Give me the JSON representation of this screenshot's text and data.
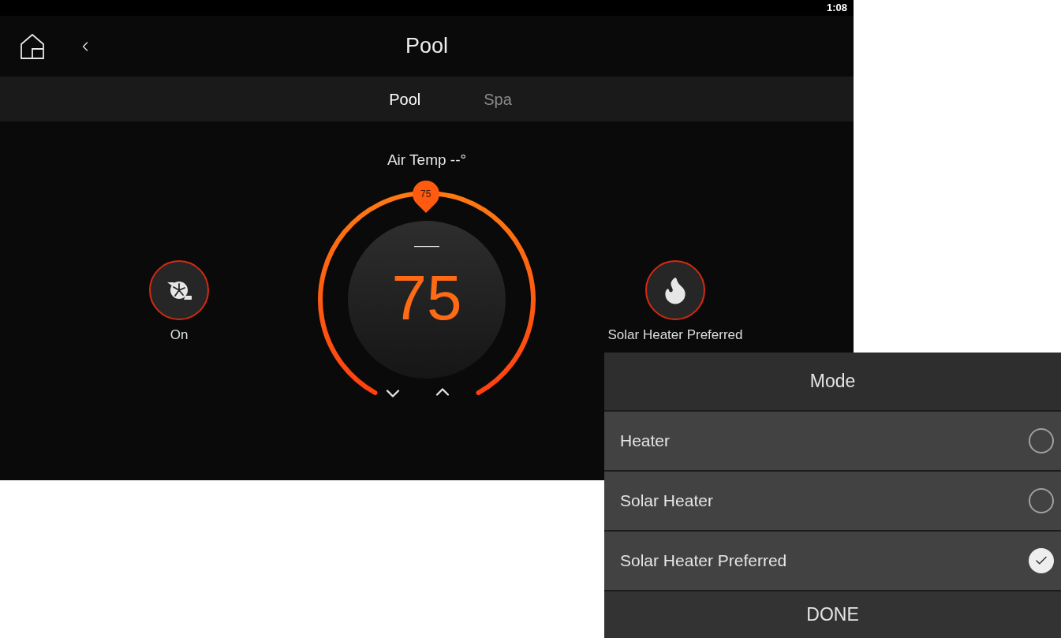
{
  "status_bar": {
    "time": "1:08"
  },
  "header": {
    "title": "Pool"
  },
  "tabs": [
    {
      "label": "Pool",
      "selected": true
    },
    {
      "label": "Spa",
      "selected": false
    }
  ],
  "air_temp": "Air Temp --°",
  "pump": {
    "label": "On",
    "active": true
  },
  "thermostat": {
    "setpoint_badge": "75",
    "current": "——",
    "setpoint": "75"
  },
  "heater": {
    "label": "Solar Heater Preferred",
    "active": true
  },
  "mode_dialog": {
    "title": "Mode",
    "options": [
      {
        "label": "Heater",
        "selected": false
      },
      {
        "label": "Solar Heater",
        "selected": false
      },
      {
        "label": "Solar Heater Preferred",
        "selected": true
      }
    ],
    "done": "DONE"
  }
}
